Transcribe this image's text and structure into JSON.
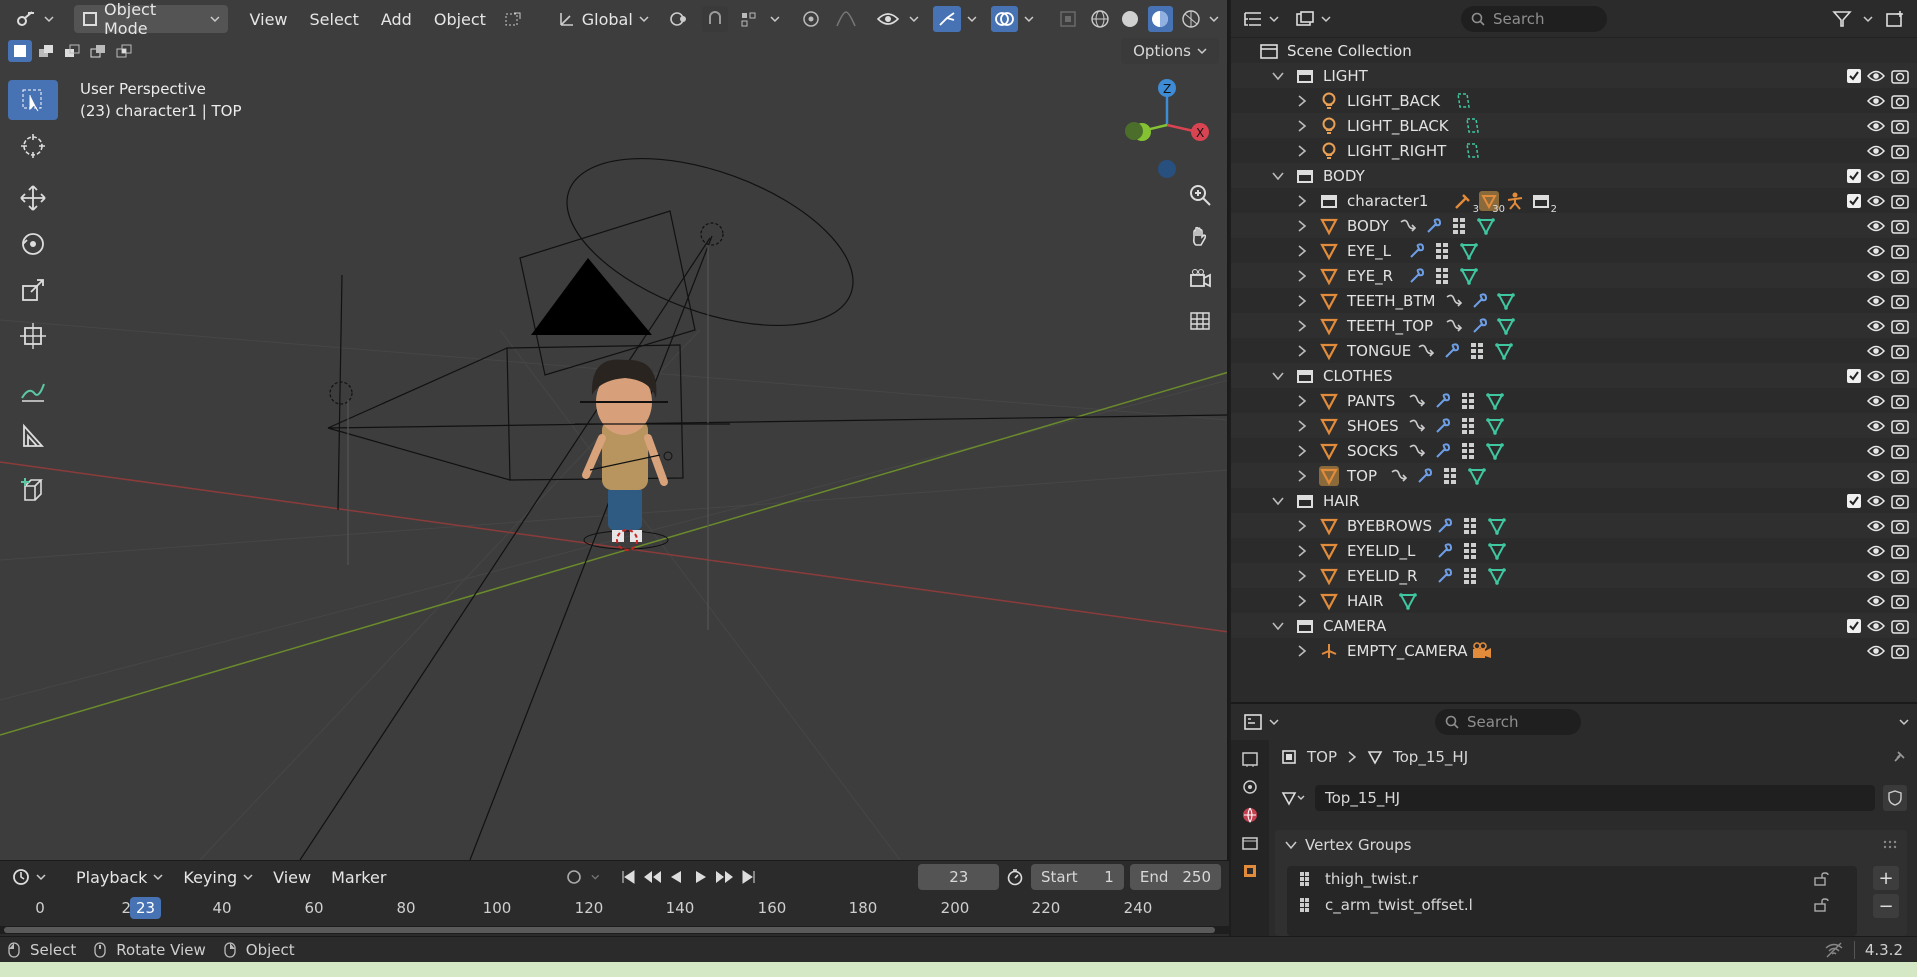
{
  "viewport": {
    "header": {
      "mode": "Object Mode",
      "menus": [
        "View",
        "Select",
        "Add",
        "Object"
      ],
      "transform_orientation": "Global"
    },
    "options_label": "Options",
    "info_line1": "User Perspective",
    "info_line2": "(23) character1 | TOP"
  },
  "outliner": {
    "search_placeholder": "Search",
    "rows": [
      {
        "indent": 0,
        "type": "scene",
        "name": "Scene Collection",
        "expand": "none",
        "checkbox": false,
        "vis": false
      },
      {
        "indent": 1,
        "type": "collection",
        "name": "LIGHT",
        "expand": "open",
        "checkbox": true,
        "vis": true,
        "extras": []
      },
      {
        "indent": 2,
        "type": "light",
        "name": "LIGHT_BACK",
        "expand": "closed",
        "checkbox": false,
        "vis": true,
        "extras": [
          "light-data"
        ]
      },
      {
        "indent": 2,
        "type": "light",
        "name": "LIGHT_BLACK",
        "expand": "closed",
        "checkbox": false,
        "vis": true,
        "extras": [
          "light-data"
        ]
      },
      {
        "indent": 2,
        "type": "light",
        "name": "LIGHT_RIGHT",
        "expand": "closed",
        "checkbox": false,
        "vis": true,
        "extras": [
          "light-data"
        ]
      },
      {
        "indent": 1,
        "type": "collection",
        "name": "BODY",
        "expand": "open",
        "checkbox": true,
        "vis": true,
        "extras": []
      },
      {
        "indent": 2,
        "type": "collection",
        "name": "character1",
        "expand": "closed",
        "checkbox": true,
        "vis": true,
        "extras": [
          "armature",
          "mesh-hl",
          "pose",
          "collection"
        ],
        "counts": [
          "3",
          "30",
          "",
          "2"
        ]
      },
      {
        "indent": 2,
        "type": "mesh",
        "name": "BODY",
        "expand": "closed",
        "checkbox": false,
        "vis": true,
        "extras": [
          "link",
          "wrench",
          "vgroup",
          "mesh-data"
        ]
      },
      {
        "indent": 2,
        "type": "mesh",
        "name": "EYE_L",
        "expand": "closed",
        "checkbox": false,
        "vis": true,
        "extras": [
          "wrench",
          "vgroup",
          "mesh-data"
        ]
      },
      {
        "indent": 2,
        "type": "mesh",
        "name": "EYE_R",
        "expand": "closed",
        "checkbox": false,
        "vis": true,
        "extras": [
          "wrench",
          "vgroup",
          "mesh-data"
        ]
      },
      {
        "indent": 2,
        "type": "mesh",
        "name": "TEETH_BTM",
        "expand": "closed",
        "checkbox": false,
        "vis": true,
        "extras": [
          "link",
          "wrench",
          "mesh-data"
        ]
      },
      {
        "indent": 2,
        "type": "mesh",
        "name": "TEETH_TOP",
        "expand": "closed",
        "checkbox": false,
        "vis": true,
        "extras": [
          "link",
          "wrench",
          "mesh-data"
        ]
      },
      {
        "indent": 2,
        "type": "mesh",
        "name": "TONGUE",
        "expand": "closed",
        "checkbox": false,
        "vis": true,
        "extras": [
          "link",
          "wrench",
          "vgroup",
          "mesh-data"
        ]
      },
      {
        "indent": 1,
        "type": "collection",
        "name": "CLOTHES",
        "expand": "open",
        "checkbox": true,
        "vis": true,
        "extras": []
      },
      {
        "indent": 2,
        "type": "mesh",
        "name": "PANTS",
        "expand": "closed",
        "checkbox": false,
        "vis": true,
        "extras": [
          "link",
          "wrench",
          "vgroup",
          "mesh-data"
        ]
      },
      {
        "indent": 2,
        "type": "mesh",
        "name": "SHOES",
        "expand": "closed",
        "checkbox": false,
        "vis": true,
        "extras": [
          "link",
          "wrench",
          "vgroup",
          "mesh-data"
        ]
      },
      {
        "indent": 2,
        "type": "mesh",
        "name": "SOCKS",
        "expand": "closed",
        "checkbox": false,
        "vis": true,
        "extras": [
          "link",
          "wrench",
          "vgroup",
          "mesh-data"
        ]
      },
      {
        "indent": 2,
        "type": "mesh",
        "name": "TOP",
        "expand": "closed",
        "checkbox": false,
        "vis": true,
        "active": true,
        "extras": [
          "link",
          "wrench",
          "vgroup",
          "mesh-data"
        ]
      },
      {
        "indent": 1,
        "type": "collection",
        "name": "HAIR",
        "expand": "open",
        "checkbox": true,
        "vis": true,
        "extras": []
      },
      {
        "indent": 2,
        "type": "mesh",
        "name": "BYEBROWS",
        "expand": "closed",
        "checkbox": false,
        "vis": true,
        "extras": [
          "wrench",
          "vgroup",
          "mesh-data"
        ]
      },
      {
        "indent": 2,
        "type": "mesh",
        "name": "EYELID_L",
        "expand": "closed",
        "checkbox": false,
        "vis": true,
        "extras": [
          "wrench",
          "vgroup",
          "mesh-data"
        ]
      },
      {
        "indent": 2,
        "type": "mesh",
        "name": "EYELID_R",
        "expand": "closed",
        "checkbox": false,
        "vis": true,
        "extras": [
          "wrench",
          "vgroup",
          "mesh-data"
        ]
      },
      {
        "indent": 2,
        "type": "mesh",
        "name": "HAIR",
        "expand": "closed",
        "checkbox": false,
        "vis": true,
        "extras": [
          "mesh-data"
        ]
      },
      {
        "indent": 1,
        "type": "collection",
        "name": "CAMERA",
        "expand": "open",
        "checkbox": true,
        "vis": true,
        "extras": []
      },
      {
        "indent": 2,
        "type": "empty",
        "name": "EMPTY_CAMERA",
        "expand": "closed",
        "checkbox": false,
        "vis": true,
        "extras": [
          "camera"
        ]
      }
    ]
  },
  "properties": {
    "search_placeholder": "Search",
    "breadcrumb_object": "TOP",
    "breadcrumb_mesh": "Top_15_HJ",
    "mesh_name": "Top_15_HJ",
    "panel_title": "Vertex Groups",
    "vertex_groups": [
      "thigh_twist.r",
      "c_arm_twist_offset.l"
    ]
  },
  "timeline": {
    "menus": [
      "Playback",
      "Keying",
      "View",
      "Marker"
    ],
    "current_frame": "23",
    "start_label": "Start",
    "start_value": "1",
    "end_label": "End",
    "end_value": "250",
    "ticks": [
      "0",
      "20",
      "40",
      "60",
      "80",
      "100",
      "120",
      "140",
      "160",
      "180",
      "200",
      "220",
      "240"
    ]
  },
  "statusbar": {
    "items": [
      "Select",
      "Rotate View",
      "Object"
    ],
    "version": "4.3.2"
  },
  "colors": {
    "accent": "#4772b3",
    "mesh": "#e28b3a",
    "modifier": "#6e9fe6",
    "mesh_data": "#3fc7a0",
    "light": "#e9a055"
  }
}
